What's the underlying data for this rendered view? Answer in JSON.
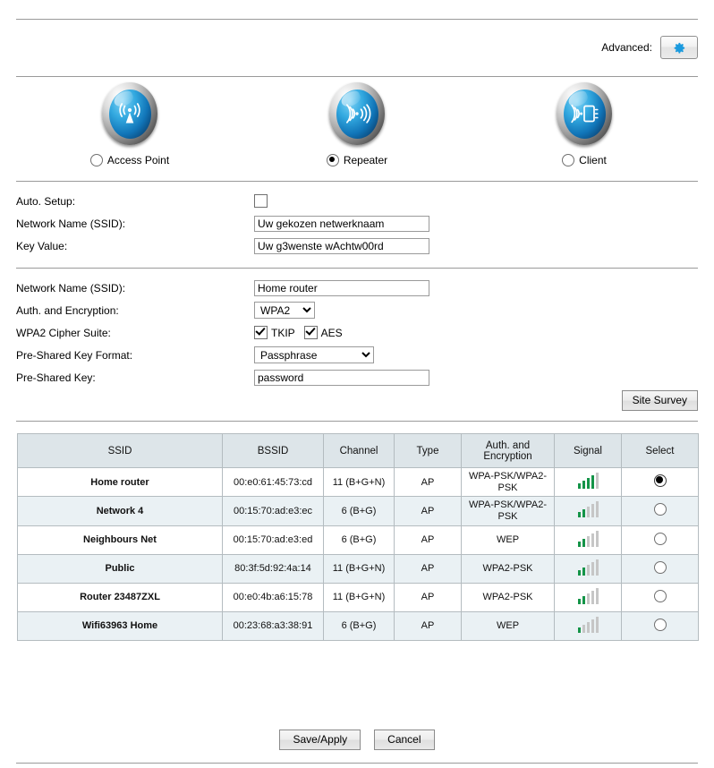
{
  "top": {
    "advanced_label": "Advanced:",
    "gear_icon": "gear-icon"
  },
  "modes": [
    {
      "label": "Access Point",
      "icon": "access-point-icon",
      "selected": false
    },
    {
      "label": "Repeater",
      "icon": "repeater-icon",
      "selected": true
    },
    {
      "label": "Client",
      "icon": "client-icon",
      "selected": false
    }
  ],
  "auto_setup": {
    "label": "Auto. Setup:",
    "checked": false
  },
  "wds_section": {
    "ssid_label": "Network Name (SSID):",
    "ssid_value": "Uw gekozen netwerknaam",
    "key_label": "Key Value:",
    "key_value": "Uw g3wenste wAchtw00rd"
  },
  "wifi_section": {
    "ssid_label": "Network Name (SSID):",
    "ssid_value": "Home router",
    "auth_label": "Auth. and Encryption:",
    "auth_value": "WPA2",
    "auth_options": [
      "WPA2"
    ],
    "cipher_label": "WPA2 Cipher Suite:",
    "cipher_tkip_label": "TKIP",
    "cipher_tkip_checked": true,
    "cipher_aes_label": "AES",
    "cipher_aes_checked": true,
    "psk_format_label": "Pre-Shared Key Format:",
    "psk_format_value": "Passphrase",
    "psk_format_options": [
      "Passphrase"
    ],
    "psk_label": "Pre-Shared Key:",
    "psk_value": "password"
  },
  "site_survey_button": "Site Survey",
  "table": {
    "headers": [
      "SSID",
      "BSSID",
      "Channel",
      "Type",
      "Auth. and Encryption",
      "Signal",
      "Select"
    ],
    "rows": [
      {
        "ssid": "Home router",
        "bssid": "00:e0:61:45:73:cd",
        "channel": "11 (B+G+N)",
        "type": "AP",
        "auth": "WPA-PSK/WPA2-PSK",
        "signal": 4,
        "signal_max": 5,
        "selected": true
      },
      {
        "ssid": "Network 4",
        "bssid": "00:15:70:ad:e3:ec",
        "channel": "6 (B+G)",
        "type": "AP",
        "auth": "WPA-PSK/WPA2-PSK",
        "signal": 2,
        "signal_max": 5,
        "selected": false
      },
      {
        "ssid": "Neighbours Net",
        "bssid": "00:15:70:ad:e3:ed",
        "channel": "6 (B+G)",
        "type": "AP",
        "auth": "WEP",
        "signal": 2,
        "signal_max": 5,
        "selected": false
      },
      {
        "ssid": "Public",
        "bssid": "80:3f:5d:92:4a:14",
        "channel": "11 (B+G+N)",
        "type": "AP",
        "auth": "WPA2-PSK",
        "signal": 2,
        "signal_max": 5,
        "selected": false
      },
      {
        "ssid": "Router 23487ZXL",
        "bssid": "00:e0:4b:a6:15:78",
        "channel": "11 (B+G+N)",
        "type": "AP",
        "auth": "WPA2-PSK",
        "signal": 2,
        "signal_max": 5,
        "selected": false
      },
      {
        "ssid": "Wifi63963 Home",
        "bssid": "00:23:68:a3:38:91",
        "channel": "6 (B+G)",
        "type": "AP",
        "auth": "WEP",
        "signal": 1,
        "signal_max": 5,
        "selected": false
      }
    ]
  },
  "footer": {
    "save_label": "Save/Apply",
    "cancel_label": "Cancel"
  },
  "colors": {
    "accent_blue": "#1a9ade",
    "signal_green": "#149448",
    "table_header_bg": "#dde5e9",
    "table_alt_row_bg": "#eaf1f4",
    "divider": "#9a9a9a"
  }
}
